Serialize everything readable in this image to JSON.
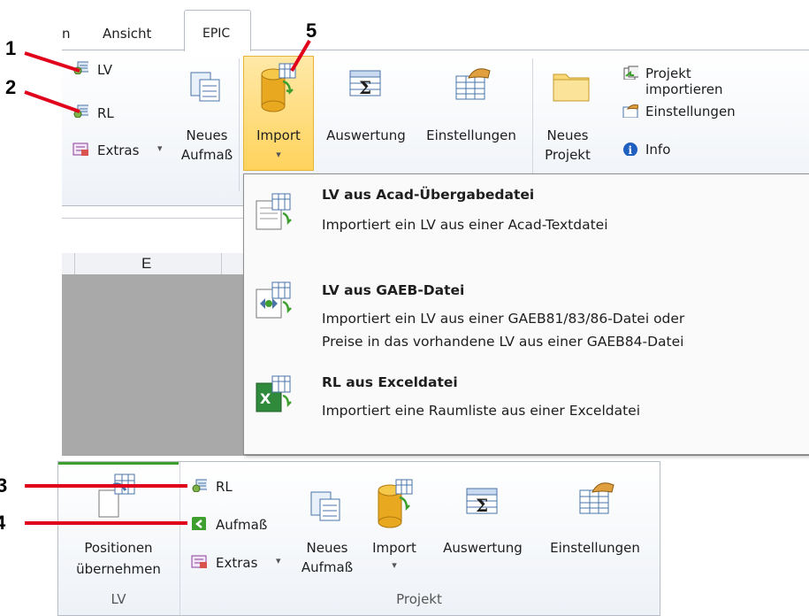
{
  "colors": {
    "callout": "#e0001b",
    "accent_import": "#ffd35c",
    "gray_sheet": "#a9a9a9"
  },
  "tabs": {
    "partial": "n",
    "ansicht": "Ansicht",
    "epic": "EPIC"
  },
  "ribbon": {
    "lv": "LV",
    "rl": "RL",
    "extras": "Extras",
    "neues_aufmass": [
      "Neues",
      "Aufmaß"
    ],
    "import": "Import",
    "auswertung": "Auswertung",
    "einstellungen": "Einstellungen",
    "neues_projekt": [
      "Neues",
      "Projekt"
    ],
    "projekt_importieren": "Projekt importieren",
    "einstellungen_small": "Einstellungen",
    "info": "Info"
  },
  "sheet": {
    "column_e": "E"
  },
  "dropdown": {
    "items": [
      {
        "title": "LV aus Acad-Übergabedatei",
        "desc": [
          "Importiert ein LV aus einer Acad-Textdatei"
        ]
      },
      {
        "title": "LV aus GAEB-Datei",
        "desc": [
          "Importiert ein LV aus einer GAEB81/83/86-Datei oder",
          "Preise in das vorhandene LV aus einer GAEB84-Datei"
        ]
      },
      {
        "title": "RL aus Exceldatei",
        "desc": [
          "Importiert eine Raumliste aus einer Exceldatei"
        ]
      }
    ]
  },
  "bottom": {
    "positionen": [
      "Positionen",
      "übernehmen"
    ],
    "rl": "RL",
    "aufmass": "Aufmaß",
    "extras": "Extras",
    "neues_aufmass": [
      "Neues",
      "Aufmaß"
    ],
    "import": "Import",
    "auswertung": "Auswertung",
    "einstellungen": "Einstellungen",
    "group_lv": "LV",
    "group_projekt": "Projekt"
  },
  "callouts": {
    "c1": "1",
    "c2": "2",
    "c3": "3",
    "c4": "4",
    "c5": "5"
  }
}
